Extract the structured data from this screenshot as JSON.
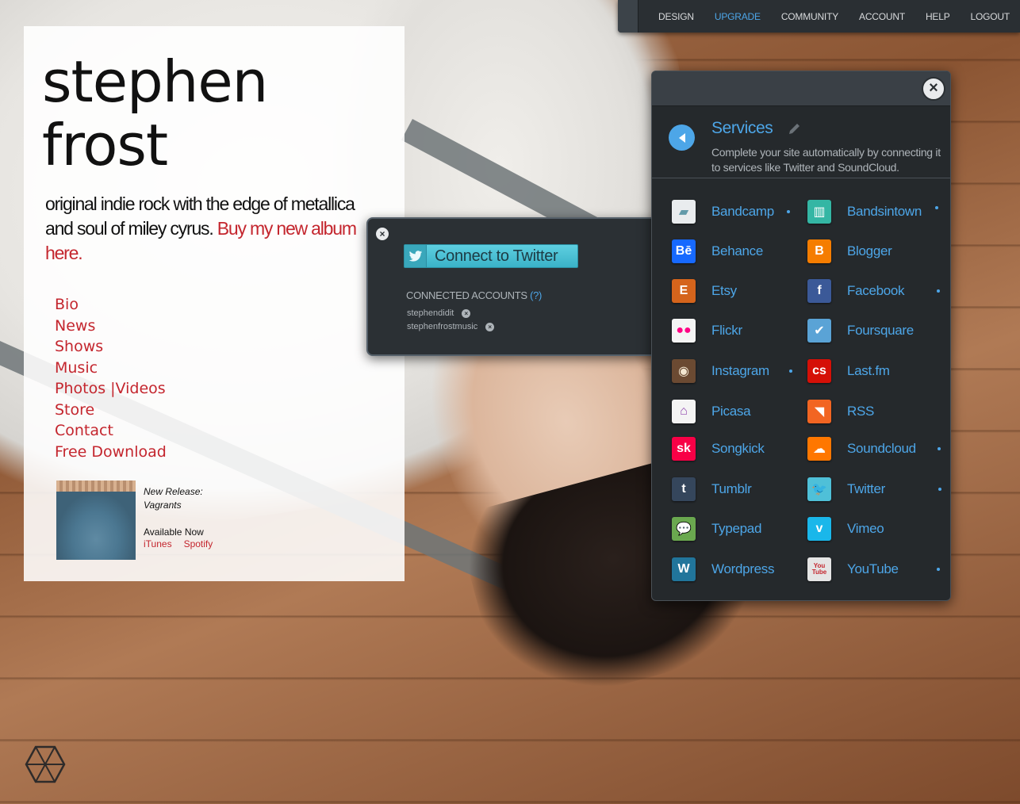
{
  "topnav": {
    "items": [
      "DESIGN",
      "UPGRADE",
      "COMMUNITY",
      "ACCOUNT",
      "HELP",
      "LOGOUT"
    ],
    "active": "UPGRADE"
  },
  "artist": {
    "name_line1": "stephen",
    "name_line2": "frost",
    "tagline": "original indie rock with the edge of metallica and soul of miley cyrus. ",
    "buy_link": "Buy my new album here."
  },
  "site_nav": [
    "Bio",
    "News",
    "Shows",
    "Music",
    "Photos |Videos",
    "Store",
    "Contact",
    "Free Download"
  ],
  "release": {
    "new_release_label": "New Release:",
    "album_title": "Vagrants",
    "available": "Available Now",
    "links": [
      "iTunes",
      "Spotify"
    ]
  },
  "twitter_popup": {
    "connect_label": "Connect to Twitter",
    "connected_title": "CONNECTED ACCOUNTS",
    "help_link": "(?)",
    "accounts": [
      "stephendidit",
      "stephenfrostmusic"
    ]
  },
  "services": {
    "title": "Services",
    "description": "Complete your site automatically by connecting it to services like Twitter and SoundCloud.",
    "accent": "#4da6e8",
    "left": [
      {
        "name": "Bandcamp",
        "icon": "bandcamp-icon",
        "glyph": "▰",
        "color": "#629aa9",
        "bg": "#e9ecee",
        "connected": true
      },
      {
        "name": "Behance",
        "icon": "behance-icon",
        "glyph": "Bē",
        "color": "#ffffff",
        "bg": "#1769ff",
        "connected": false
      },
      {
        "name": "Etsy",
        "icon": "etsy-icon",
        "glyph": "E",
        "color": "#ffffff",
        "bg": "#d5641c",
        "connected": false
      },
      {
        "name": "Flickr",
        "icon": "flickr-icon",
        "glyph": "●●",
        "color": "#ff0084",
        "bg": "#f4f4f4",
        "connected": false
      },
      {
        "name": "Instagram",
        "icon": "instagram-icon",
        "glyph": "◉",
        "color": "#f2e6d0",
        "bg": "#6b4a32",
        "connected": true
      },
      {
        "name": "Picasa",
        "icon": "picasa-icon",
        "glyph": "⌂",
        "color": "#8e44ad",
        "bg": "#f4f4f4",
        "connected": false
      },
      {
        "name": "Songkick",
        "icon": "songkick-icon",
        "glyph": "sk",
        "color": "#ffffff",
        "bg": "#f80046",
        "connected": false
      },
      {
        "name": "Tumblr",
        "icon": "tumblr-icon",
        "glyph": "t",
        "color": "#ffffff",
        "bg": "#35465c",
        "connected": false
      },
      {
        "name": "Typepad",
        "icon": "typepad-icon",
        "glyph": "💬",
        "color": "#ffffff",
        "bg": "#6aa84f",
        "connected": false
      },
      {
        "name": "Wordpress",
        "icon": "wordpress-icon",
        "glyph": "W",
        "color": "#ffffff",
        "bg": "#21759b",
        "connected": false
      }
    ],
    "right": [
      {
        "name": "Bandsintown",
        "icon": "bandsintown-icon",
        "glyph": "▥",
        "color": "#ffffff",
        "bg": "#34b6a4",
        "connected": true
      },
      {
        "name": "Blogger",
        "icon": "blogger-icon",
        "glyph": "B",
        "color": "#ffffff",
        "bg": "#f57d00",
        "connected": false
      },
      {
        "name": "Facebook",
        "icon": "facebook-icon",
        "glyph": "f",
        "color": "#ffffff",
        "bg": "#3b5998",
        "connected": true
      },
      {
        "name": "Foursquare",
        "icon": "foursquare-icon",
        "glyph": "✔",
        "color": "#ffffff",
        "bg": "#5aa3d6",
        "connected": false
      },
      {
        "name": "Last.fm",
        "icon": "lastfm-icon",
        "glyph": "cs",
        "color": "#ffffff",
        "bg": "#d51007",
        "connected": false
      },
      {
        "name": "RSS",
        "icon": "rss-icon",
        "glyph": "◥",
        "color": "#ffffff",
        "bg": "#f26522",
        "connected": false
      },
      {
        "name": "Soundcloud",
        "icon": "soundcloud-icon",
        "glyph": "☁",
        "color": "#ffffff",
        "bg": "#ff7700",
        "connected": true
      },
      {
        "name": "Twitter",
        "icon": "twitter-icon",
        "glyph": "🐦",
        "color": "#ffffff",
        "bg": "#4fc0d8",
        "connected": true
      },
      {
        "name": "Vimeo",
        "icon": "vimeo-icon",
        "glyph": "v",
        "color": "#ffffff",
        "bg": "#1ab7ea",
        "connected": false
      },
      {
        "name": "YouTube",
        "icon": "youtube-icon",
        "glyph": "You Tube",
        "color": "#ffffff",
        "bg": "#e5e5e5",
        "connected": true
      }
    ]
  }
}
